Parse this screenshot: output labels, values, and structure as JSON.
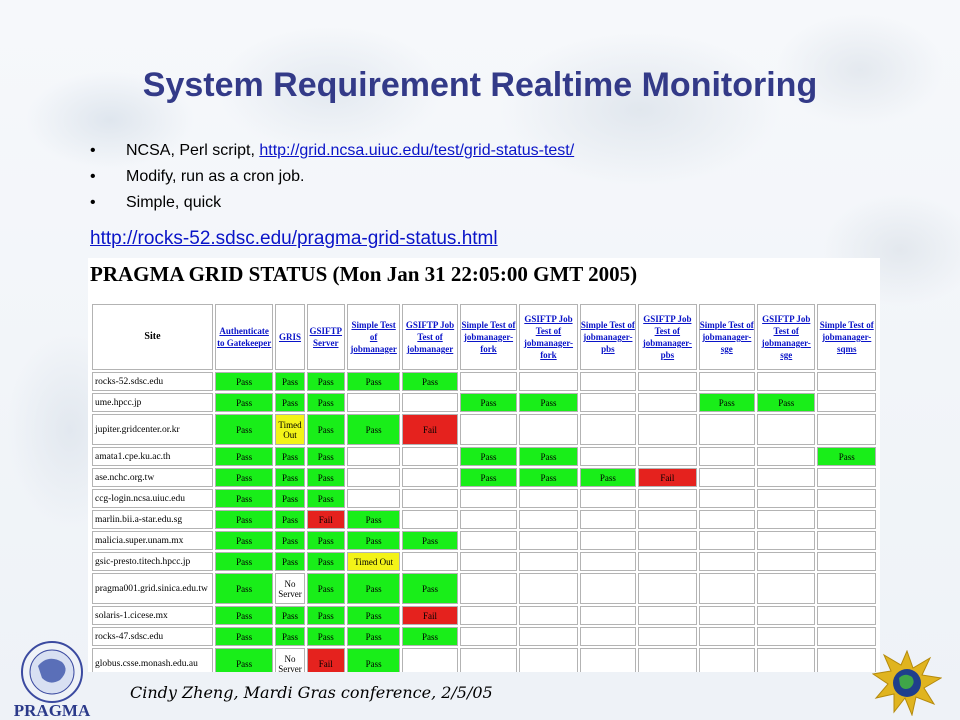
{
  "slide": {
    "title": "System Requirement Realtime Monitoring",
    "bullets": [
      {
        "text": "NCSA, Perl script, ",
        "link": "http://grid.ncsa.uiuc.edu/test/grid-status-test/"
      },
      {
        "text": "Modify, run as a cron job.",
        "link": ""
      },
      {
        "text": "Simple, quick",
        "link": ""
      }
    ],
    "bullet_glyph": "•",
    "main_link": "http://rocks-52.sdsc.edu/pragma-grid-status.html",
    "footer": "Cindy Zheng, Mardi Gras conference, 2/5/05"
  },
  "status_page": {
    "title": "PRAGMA GRID STATUS (Mon Jan 31 22:05:00 GMT 2005)",
    "columns": [
      "Site",
      "Authenticate to Gatekeeper",
      "GRIS",
      "GSIFTP Server",
      "Simple Test of jobmanager",
      "GSIFTP Job Test of jobmanager",
      "Simple Test of jobmanager-fork",
      "GSIFTP Job Test of jobmanager-fork",
      "Simple Test of jobmanager-pbs",
      "GSIFTP Job Test of jobmanager-pbs",
      "Simple Test of jobmanager-sge",
      "GSIFTP Job Test of jobmanager-sge",
      "Simple Test of jobmanager-sqms"
    ],
    "rows": [
      {
        "site": "rocks-52.sdsc.edu",
        "cells": [
          "Pass",
          "Pass",
          "Pass",
          "Pass",
          "Pass",
          "",
          "",
          "",
          "",
          "",
          "",
          ""
        ]
      },
      {
        "site": "ume.hpcc.jp",
        "cells": [
          "Pass",
          "Pass",
          "Pass",
          "",
          "",
          "Pass",
          "Pass",
          "",
          "",
          "Pass",
          "Pass",
          ""
        ]
      },
      {
        "site": "jupiter.gridcenter.or.kr",
        "cells": [
          "Pass",
          "Timed Out",
          "Pass",
          "Pass",
          "Fail",
          "",
          "",
          "",
          "",
          "",
          "",
          ""
        ]
      },
      {
        "site": "amata1.cpe.ku.ac.th",
        "cells": [
          "Pass",
          "Pass",
          "Pass",
          "",
          "",
          "Pass",
          "Pass",
          "",
          "",
          "",
          "",
          "Pass"
        ]
      },
      {
        "site": "ase.nchc.org.tw",
        "cells": [
          "Pass",
          "Pass",
          "Pass",
          "",
          "",
          "Pass",
          "Pass",
          "Pass",
          "Fail",
          "",
          "",
          ""
        ]
      },
      {
        "site": "ccg-login.ncsa.uiuc.edu",
        "cells": [
          "Pass",
          "Pass",
          "Pass",
          "",
          "",
          "",
          "",
          "",
          "",
          "",
          "",
          ""
        ]
      },
      {
        "site": "marlin.bii.a-star.edu.sg",
        "cells": [
          "Pass",
          "Pass",
          "Fail",
          "Pass",
          "",
          "",
          "",
          "",
          "",
          "",
          "",
          ""
        ]
      },
      {
        "site": "malicia.super.unam.mx",
        "cells": [
          "Pass",
          "Pass",
          "Pass",
          "Pass",
          "Pass",
          "",
          "",
          "",
          "",
          "",
          "",
          ""
        ]
      },
      {
        "site": "gsic-presto.titech.hpcc.jp",
        "cells": [
          "Pass",
          "Pass",
          "Pass",
          "Timed Out",
          "",
          "",
          "",
          "",
          "",
          "",
          "",
          ""
        ]
      },
      {
        "site": "pragma001.grid.sinica.edu.tw",
        "cells": [
          "Pass",
          "No Server",
          "Pass",
          "Pass",
          "Pass",
          "",
          "",
          "",
          "",
          "",
          "",
          ""
        ]
      },
      {
        "site": "solaris-1.cicese.mx",
        "cells": [
          "Pass",
          "Pass",
          "Pass",
          "Pass",
          "Fail",
          "",
          "",
          "",
          "",
          "",
          "",
          ""
        ]
      },
      {
        "site": "rocks-47.sdsc.edu",
        "cells": [
          "Pass",
          "Pass",
          "Pass",
          "Pass",
          "Pass",
          "",
          "",
          "",
          "",
          "",
          "",
          ""
        ]
      },
      {
        "site": "globus.csse.monash.edu.au",
        "cells": [
          "Pass",
          "No Server",
          "Fail",
          "Pass",
          "",
          "",
          "",
          "",
          "",
          "",
          "",
          ""
        ]
      }
    ]
  },
  "logos": {
    "left": {
      "name": "pragma-logo",
      "text": "PRAGMA"
    },
    "right": {
      "name": "gold-star-globe-logo"
    }
  },
  "colors": {
    "title": "#333a88",
    "link": "#0a14c8",
    "pass": "#19ee19",
    "fail": "#e5221e",
    "timed_out": "#f3f318"
  }
}
